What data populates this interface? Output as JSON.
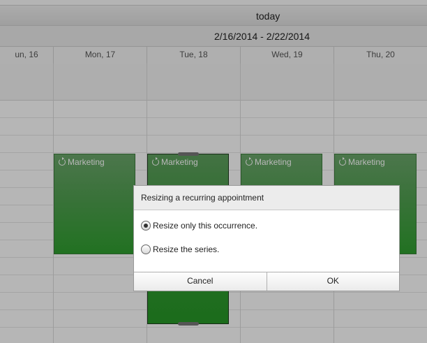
{
  "toolbar": {
    "today_label": "today",
    "date_range": "2/16/2014 - 2/22/2014"
  },
  "days": [
    {
      "label": "un, 16"
    },
    {
      "label": "Mon, 17"
    },
    {
      "label": "Tue, 18"
    },
    {
      "label": "Wed, 19"
    },
    {
      "label": "Thu, 20"
    }
  ],
  "appointments": [
    {
      "title": "Marketing",
      "day": "Mon, 17",
      "icon": "recurrence-icon"
    },
    {
      "title": "Marketing",
      "day": "Tue, 18",
      "icon": "recurrence-icon",
      "selected": true
    },
    {
      "title": "Marketing",
      "day": "Wed, 19",
      "icon": "recurrence-icon"
    },
    {
      "title": "Marketing",
      "day": "Thu, 20",
      "icon": "recurrence-icon"
    }
  ],
  "dialog": {
    "title": "Resizing a recurring appointment",
    "options": [
      {
        "label": "Resize only this occurrence.",
        "checked": true
      },
      {
        "label": "Resize the series.",
        "checked": false
      }
    ],
    "cancel_label": "Cancel",
    "ok_label": "OK"
  },
  "colors": {
    "appointment": "#3d9a3d",
    "appointment_border": "#3b7a3b"
  }
}
